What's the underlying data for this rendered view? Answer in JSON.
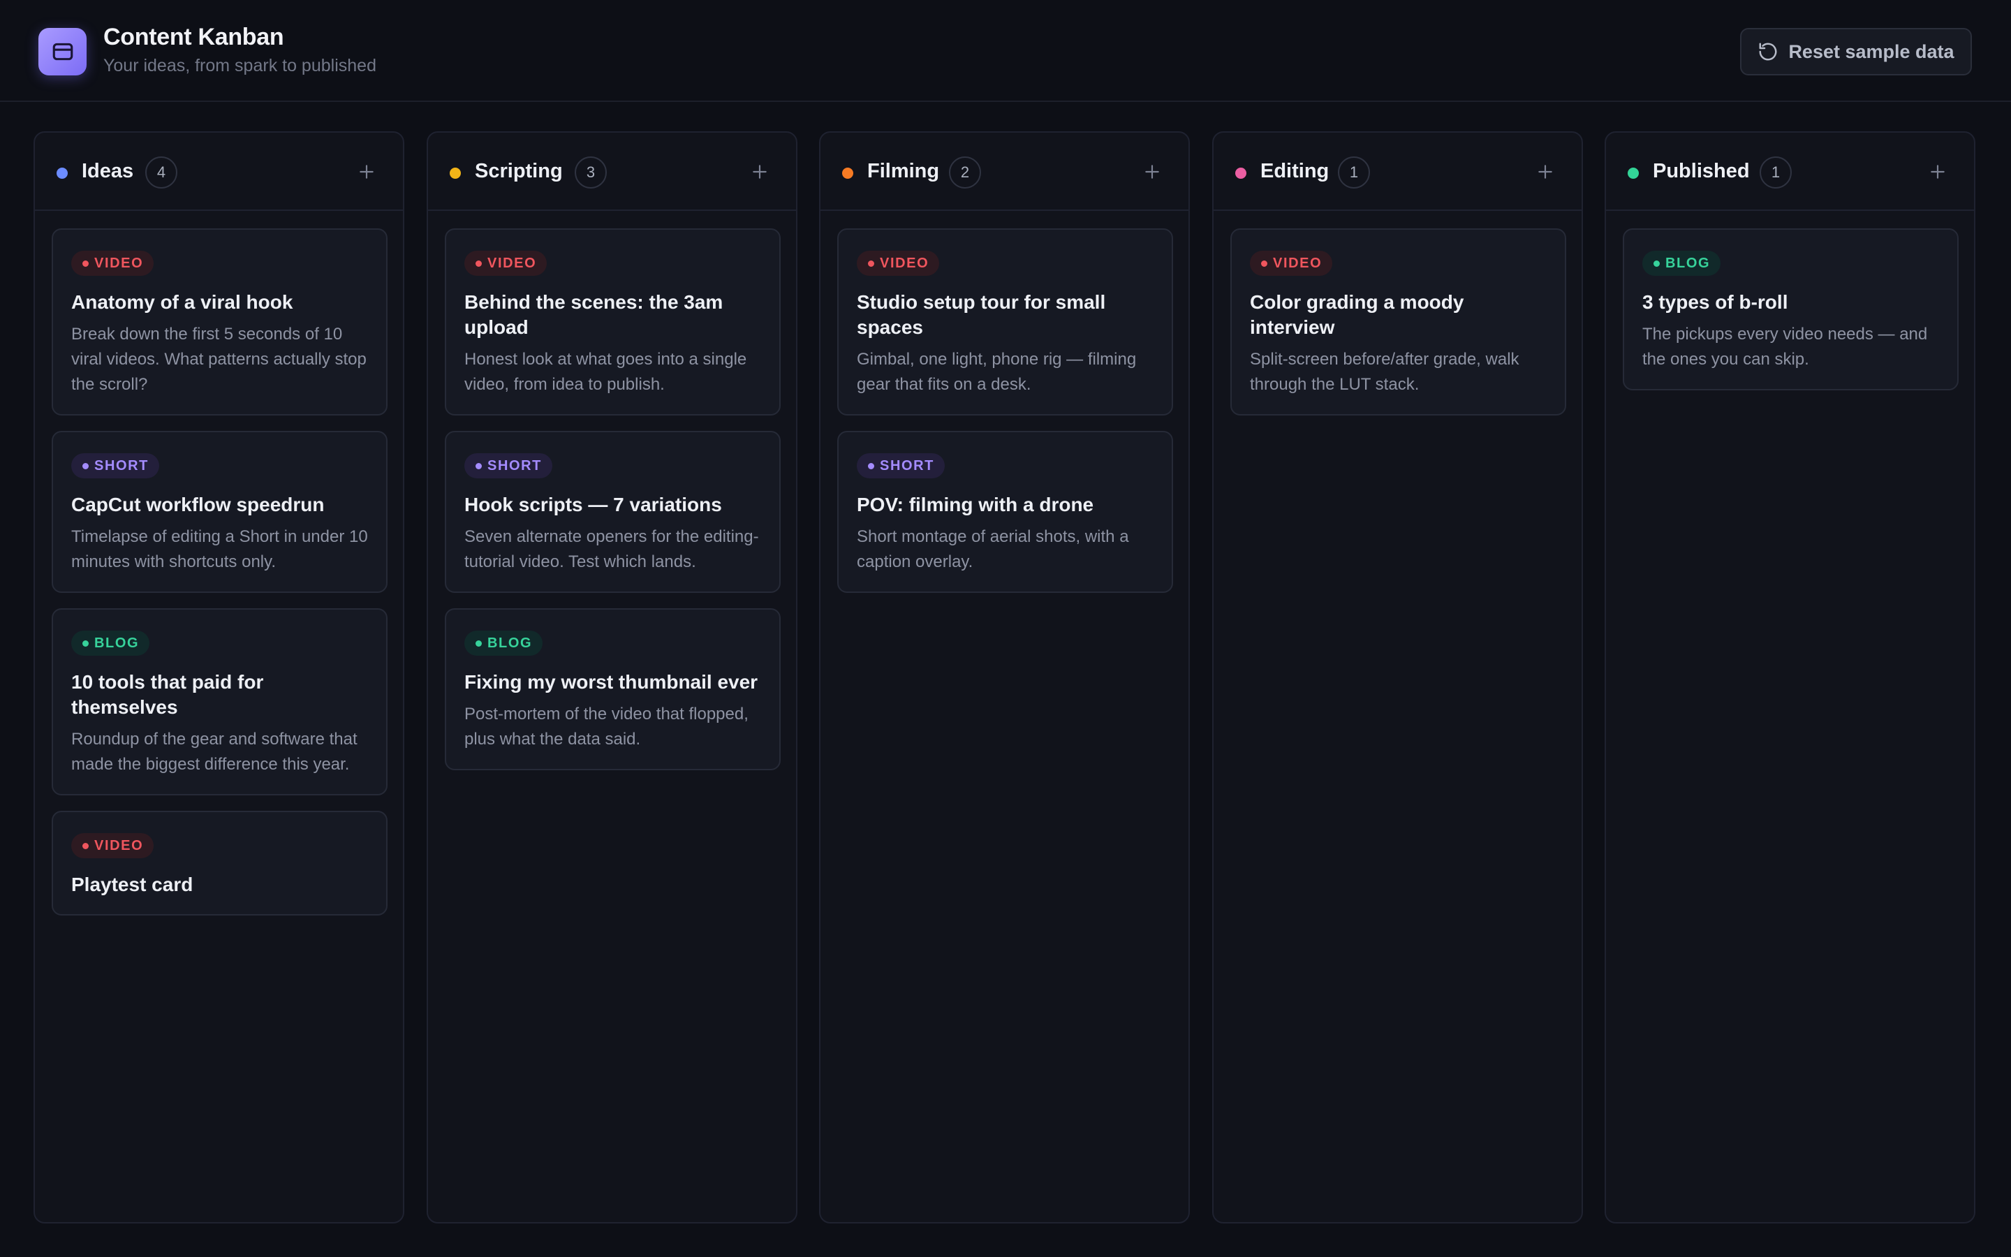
{
  "header": {
    "title": "Content Kanban",
    "subtitle": "Your ideas, from spark to published",
    "reset_label": "Reset sample data"
  },
  "columns": [
    {
      "key": "ideas",
      "title": "Ideas",
      "count": "4",
      "color": "#6c8cff",
      "cards": [
        {
          "type": "video",
          "tag": "VIDEO",
          "title": "Anatomy of a viral hook",
          "desc": "Break down the first 5 seconds of 10 viral videos. What patterns actually stop the scroll?"
        },
        {
          "type": "short",
          "tag": "SHORT",
          "title": "CapCut workflow speedrun",
          "desc": "Timelapse of editing a Short in under 10 minutes with shortcuts only."
        },
        {
          "type": "blog",
          "tag": "BLOG",
          "title": "10 tools that paid for themselves",
          "desc": "Roundup of the gear and software that made the biggest difference this year."
        },
        {
          "type": "video",
          "tag": "VIDEO",
          "title": "Playtest card",
          "desc": ""
        }
      ]
    },
    {
      "key": "scripting",
      "title": "Scripting",
      "count": "3",
      "color": "#f2b418",
      "cards": [
        {
          "type": "video",
          "tag": "VIDEO",
          "title": "Behind the scenes: the 3am upload",
          "desc": "Honest look at what goes into a single video, from idea to publish."
        },
        {
          "type": "short",
          "tag": "SHORT",
          "title": "Hook scripts — 7 variations",
          "desc": "Seven alternate openers for the editing-tutorial video. Test which lands."
        },
        {
          "type": "blog",
          "tag": "BLOG",
          "title": "Fixing my worst thumbnail ever",
          "desc": "Post-mortem of the video that flopped, plus what the data said."
        }
      ]
    },
    {
      "key": "filming",
      "title": "Filming",
      "count": "2",
      "color": "#f77b24",
      "cards": [
        {
          "type": "video",
          "tag": "VIDEO",
          "title": "Studio setup tour for small spaces",
          "desc": "Gimbal, one light, phone rig — filming gear that fits on a desk."
        },
        {
          "type": "short",
          "tag": "SHORT",
          "title": "POV: filming with a drone",
          "desc": "Short montage of aerial shots, with a caption overlay."
        }
      ]
    },
    {
      "key": "editing",
      "title": "Editing",
      "count": "1",
      "color": "#ec5fa3",
      "cards": [
        {
          "type": "video",
          "tag": "VIDEO",
          "title": "Color grading a moody interview",
          "desc": "Split-screen before/after grade, walk through the LUT stack."
        }
      ]
    },
    {
      "key": "published",
      "title": "Published",
      "count": "1",
      "color": "#33d497",
      "cards": [
        {
          "type": "blog",
          "tag": "BLOG",
          "title": "3 types of b-roll",
          "desc": "The pickups every video needs — and the ones you can skip."
        }
      ]
    }
  ]
}
